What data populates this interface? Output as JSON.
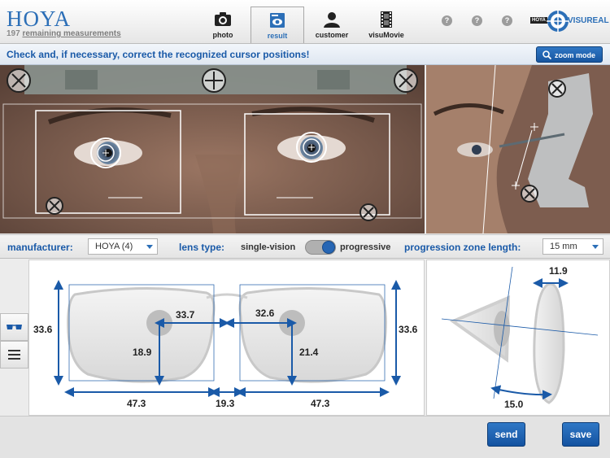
{
  "header": {
    "brand": "HOYA",
    "remaining_count": "197",
    "remaining_text": "remaining measurements",
    "tabs": [
      {
        "label": "photo"
      },
      {
        "label": "result"
      },
      {
        "label": "customer"
      },
      {
        "label": "visuMovie"
      }
    ],
    "help": [
      "?",
      "?",
      "?"
    ],
    "logo_small": "HOYA",
    "logo_main": "VISUREAL"
  },
  "instruction": {
    "text": "Check and, if necessary, correct the recognized cursor positions!",
    "zoom_label": "zoom mode"
  },
  "controls": {
    "manufacturer_label": "manufacturer:",
    "manufacturer_value": "HOYA (4)",
    "lens_type_label": "lens type:",
    "lens_option_left": "single-vision",
    "lens_option_right": "progressive",
    "progression_label": "progression zone length:",
    "progression_value": "15 mm"
  },
  "front_measurements": {
    "frame_height_left": "33.6",
    "frame_height_right": "33.6",
    "pd_left": "33.7",
    "pd_right": "32.6",
    "fitting_height_left": "18.9",
    "fitting_height_right": "21.4",
    "box_width_left": "47.3",
    "bridge": "19.3",
    "box_width_right": "47.3"
  },
  "side_measurements": {
    "vertex_distance": "11.9",
    "pantoscopic": "15.0"
  },
  "footer": {
    "send_label": "send",
    "save_label": "save"
  },
  "colors": {
    "accent": "#2c6fb7",
    "button": "#1755a0"
  }
}
